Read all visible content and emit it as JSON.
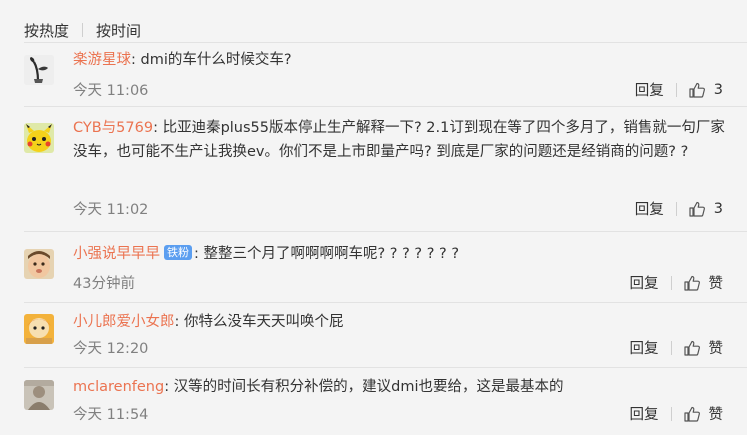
{
  "sort_tabs": [
    "按热度",
    "按时间"
  ],
  "comments": [
    {
      "user": "楽游星球",
      "text": "dmi的车什么时候交车?",
      "badge": "",
      "time": "今天 11:06",
      "reply_label": "回复",
      "like": "3",
      "avatar_icon": "plant-sprout-icon"
    },
    {
      "user": "CYB与5769",
      "text": "比亚迪秦plus55版本停止生产解释一下? 2.1订到现在等了四个多月了，销售就一句厂家没车，也可能不生产让我换ev。你们不是上市即量产吗? 到底是厂家的问题还是经销商的问题? ?",
      "badge": "",
      "time": "今天 11:02",
      "reply_label": "回复",
      "like": "3",
      "avatar_icon": "pikachu-icon"
    },
    {
      "user": "小强说早早早",
      "text": "整整三个月了啊啊啊啊车呢? ? ? ? ? ? ?",
      "badge": "铁粉",
      "time": "43分钟前",
      "reply_label": "回复",
      "like": "赞",
      "avatar_icon": "baby-face-icon"
    },
    {
      "user": "小儿郎爱小女郎",
      "text": "你特么没车天天叫唤个屁",
      "badge": "",
      "time": "今天 12:20",
      "reply_label": "回复",
      "like": "赞",
      "avatar_icon": "cartoon-character-icon"
    },
    {
      "user": "mclarenfeng",
      "text": "汉等的时间长有积分补偿的，建议dmi也要给，这是最基本的",
      "badge": "",
      "time": "今天 11:54",
      "reply_label": "回复",
      "like": "赞",
      "avatar_icon": "person-photo-icon"
    }
  ],
  "colors": {
    "username": "#eb7350",
    "background": "#f4f4f4",
    "meta": "#808080",
    "badge": "#5b9ef0"
  }
}
